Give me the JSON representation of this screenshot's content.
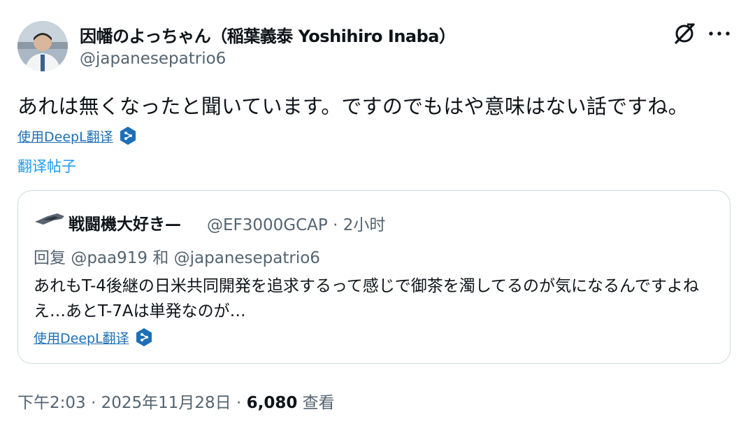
{
  "author": {
    "display_name": "因幡のよっちゃん（稲葉義泰 Yoshihiro Inaba）",
    "handle": "@japanesepatrio6"
  },
  "tweet": {
    "text": "あれは無くなったと聞いています。ですのでもはや意味はない話ですね。",
    "translate_deepl": "使用DeepL翻译",
    "translate_post": "翻译帖子"
  },
  "quote": {
    "author_name": "戦闘機大好き—",
    "meta": "@EF3000GCAP · 2小时",
    "reply_prefix": "回复",
    "reply_to_1": "@paa919",
    "reply_and": "和",
    "reply_to_2": "@japanesepatrio6",
    "text": "あれもT-4後継の日米共同開発を追求するって感じで御茶を濁してるのが気になるんですよねえ…あとT-7Aは単発なのが…",
    "translate_deepl": "使用DeepL翻译"
  },
  "footer": {
    "time": "下午2:03",
    "sep1": " · ",
    "date": "2025年11月28日",
    "sep2": " · ",
    "views_count": "6,080",
    "views_label": " 查看"
  },
  "icons": {
    "grok": "grok-icon",
    "more": "more-icon",
    "deepl": "deepl-icon",
    "avatar": "avatar",
    "plane": "fighter-jet-avatar"
  },
  "colors": {
    "link": "#1d9bf0",
    "muted": "#536471",
    "text": "#0f1419",
    "border": "#cfd9de"
  }
}
